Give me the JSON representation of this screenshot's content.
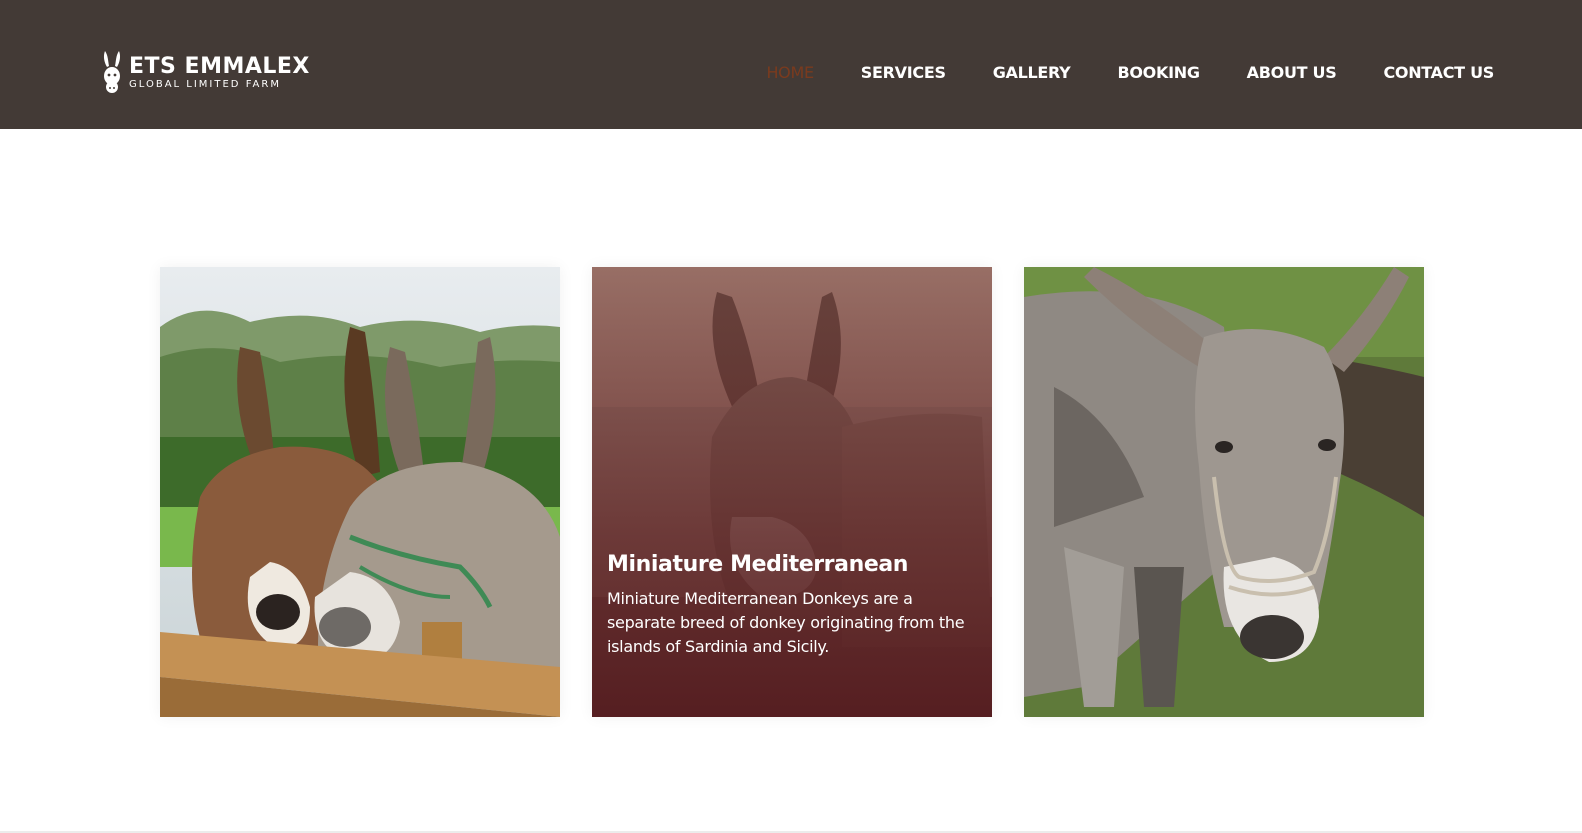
{
  "brand": {
    "title": "ETS EMMALEX",
    "subtitle": "GLOBAL LIMITED FARM",
    "icon": "donkey-head-icon"
  },
  "nav": {
    "items": [
      {
        "label": "HOME",
        "active": true
      },
      {
        "label": "SERVICES",
        "active": false
      },
      {
        "label": "GALLERY",
        "active": false
      },
      {
        "label": "BOOKING",
        "active": false
      },
      {
        "label": "ABOUT US",
        "active": false
      },
      {
        "label": "CONTACT US",
        "active": false
      }
    ]
  },
  "cards": [
    {
      "image": "two-donkeys-at-fence-photo"
    },
    {
      "image": "miniature-donkey-photo",
      "title": "Miniature Mediterranean",
      "description": "Miniature Mediterranean Donkeys are a separate breed of donkey originating from the islands of Sardinia and Sicily."
    },
    {
      "image": "grey-donkey-with-halter-photo"
    }
  ],
  "colors": {
    "header_bg": "#433a36",
    "nav_active": "#7a3a1e",
    "card_overlay": "#5a1e22"
  }
}
